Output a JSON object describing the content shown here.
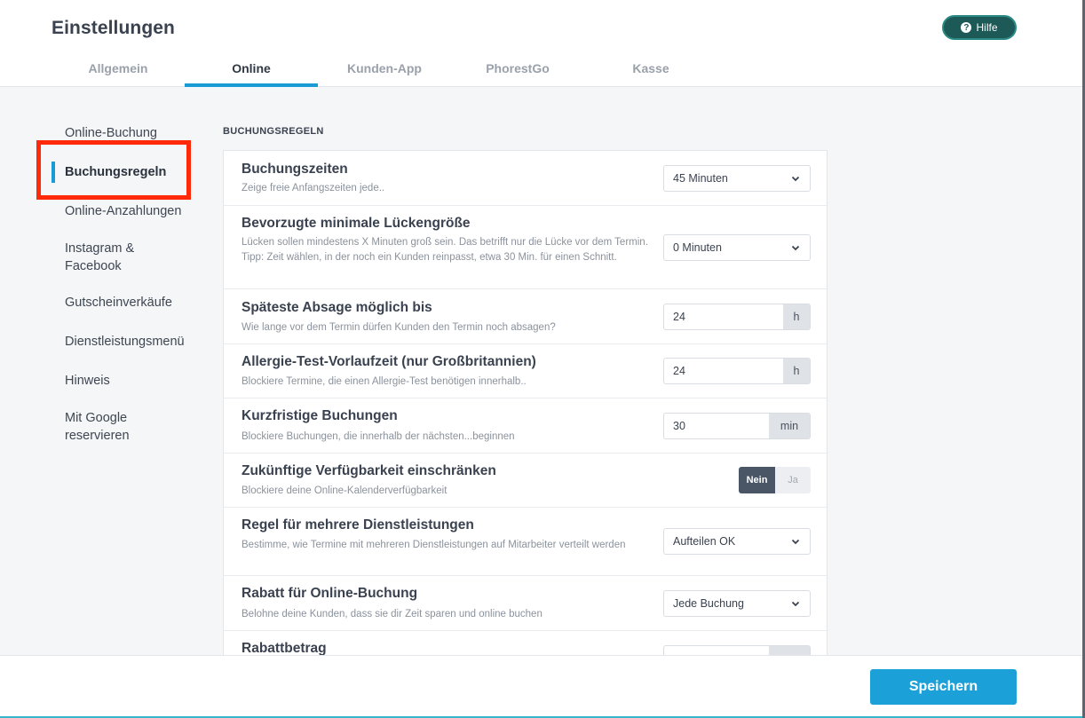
{
  "header": {
    "title": "Einstellungen",
    "help_label": "Hilfe",
    "tabs": [
      {
        "label": "Allgemein"
      },
      {
        "label": "Online"
      },
      {
        "label": "Kunden-App"
      },
      {
        "label": "PhorestGo"
      },
      {
        "label": "Kasse"
      }
    ]
  },
  "sidebar": {
    "items": [
      {
        "label": "Online-Buchung"
      },
      {
        "label": "Buchungsregeln"
      },
      {
        "label": "Online-Anzahlungen"
      },
      {
        "label": "Instagram & Facebook"
      },
      {
        "label": "Gutscheinverkäufe"
      },
      {
        "label": "Dienstleistungsmenü"
      },
      {
        "label": "Hinweis"
      },
      {
        "label": "Mit Google reservieren"
      }
    ]
  },
  "main": {
    "section_title": "BUCHUNGSREGELN",
    "rows": [
      {
        "title": "Buchungszeiten",
        "desc": "Zeige freie Anfangszeiten jede..",
        "value": "45 Minuten"
      },
      {
        "title": "Bevorzugte minimale Lückengröße",
        "desc": "Lücken sollen mindestens X Minuten groß sein. Das betrifft nur die Lücke vor dem Termin. Tipp: Zeit wählen, in der noch ein Kunden reinpasst, etwa 30 Min. für einen Schnitt.",
        "value": "0 Minuten"
      },
      {
        "title": "Späteste Absage möglich bis",
        "desc": "Wie lange vor dem Termin dürfen Kunden den Termin noch absagen?",
        "value": "24",
        "unit": "h"
      },
      {
        "title": "Allergie-Test-Vorlaufzeit (nur Großbritannien)",
        "desc": "Blockiere Termine, die einen Allergie-Test benötigen innerhalb..",
        "value": "24",
        "unit": "h"
      },
      {
        "title": "Kurzfristige Buchungen",
        "desc": "Blockiere Buchungen, die innerhalb der nächsten...beginnen",
        "value": "30",
        "unit": "min"
      },
      {
        "title": "Zukünftige Verfügbarkeit einschränken",
        "desc": "Blockiere deine Online-Kalenderverfügbarkeit",
        "toggle_on": "Nein",
        "toggle_off": "Ja"
      },
      {
        "title": "Regel für mehrere Dienstleistungen",
        "desc": "Bestimme, wie Termine mit mehreren Dienstleistungen auf Mitarbeiter verteilt werden",
        "value": "Aufteilen OK"
      },
      {
        "title": "Rabatt für Online-Buchung",
        "desc": "Belohne deine Kunden, dass sie dir Zeit sparen und online buchen",
        "value": "Jede Buchung"
      },
      {
        "title": "Rabattbetrag"
      }
    ]
  },
  "footer": {
    "save_label": "Speichern"
  },
  "colors": {
    "accent": "#1a9bd5",
    "help_button": "#1d5a57",
    "highlight": "#ff2a0a",
    "toggle_active": "#4a5566"
  }
}
